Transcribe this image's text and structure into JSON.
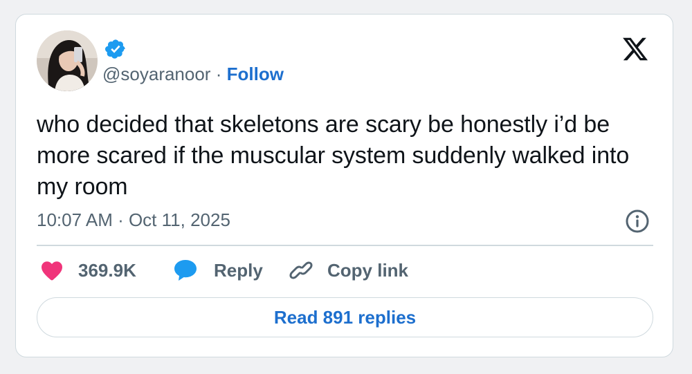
{
  "user": {
    "handle": "@soyaranoor",
    "separator": "·",
    "follow_label": "Follow",
    "verified": true
  },
  "tweet": {
    "text": "who decided that skeletons are scary be honestly i’d be more scared if the muscular system suddenly walked into my room",
    "timestamp": "10:07 AM · Oct 11, 2025"
  },
  "actions": {
    "like_count": "369.9K",
    "reply_label": "Reply",
    "copy_link_label": "Copy link"
  },
  "footer": {
    "read_replies_label": "Read 891 replies"
  },
  "icons": {
    "brand": "x-logo-icon",
    "verified": "verified-badge-icon",
    "info": "info-icon",
    "like": "heart-icon",
    "reply": "speech-bubble-icon",
    "copy": "link-icon"
  },
  "colors": {
    "accent_blue": "#1d6fce",
    "heart_pink": "#f0347a",
    "reply_blue": "#1d9bf0",
    "muted_text": "#536471",
    "border": "#cfd9de"
  }
}
